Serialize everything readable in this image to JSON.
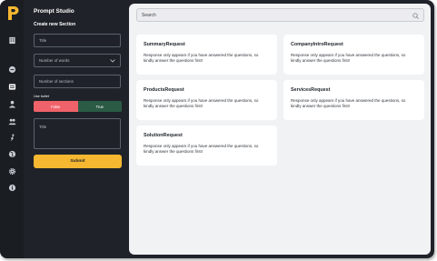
{
  "app": {
    "title": "Prompt Studio"
  },
  "rail": {
    "items": [
      {
        "icon": "building-icon"
      },
      {
        "icon": "chat-icon"
      },
      {
        "icon": "list-icon",
        "active": true
      },
      {
        "icon": "user-icon"
      },
      {
        "icon": "users-icon"
      },
      {
        "icon": "run-icon"
      },
      {
        "icon": "globe-icon"
      },
      {
        "icon": "gear-icon"
      },
      {
        "icon": "info-icon"
      }
    ]
  },
  "form": {
    "heading": "Create new Section",
    "title_placeholder": "Title",
    "words_placeholder": "Number of words",
    "sections_placeholder": "Number of sections",
    "bullet_label": "Use bullet",
    "bullet_false": "False",
    "bullet_true": "True",
    "body_placeholder": "Title",
    "submit_label": "Submit"
  },
  "search": {
    "placeholder": "Search"
  },
  "cards": [
    {
      "title": "SummaryRequest",
      "text": "Response only appears if you have answered the questions, so kindly answer the questions first!"
    },
    {
      "title": "CompanyIntroRequest",
      "text": "Response only appears if you have answered the questions, so kindly answer the questions first!"
    },
    {
      "title": "ProductsRequest",
      "text": "Response only appears if you have answered the questions, so kindly answer the questions first!"
    },
    {
      "title": "ServicesRequest",
      "text": "Response only appears if you have answered the questions, so kindly answer the questions first!"
    },
    {
      "title": "SolutionRequest",
      "text": "Response only appears if you have answered the questions, so kindly answer the questions first!"
    }
  ],
  "colors": {
    "sidebar": "#1f2329",
    "accent": "#f6b731",
    "toggle_false": "#f0626a",
    "toggle_true": "#2b5a45"
  }
}
